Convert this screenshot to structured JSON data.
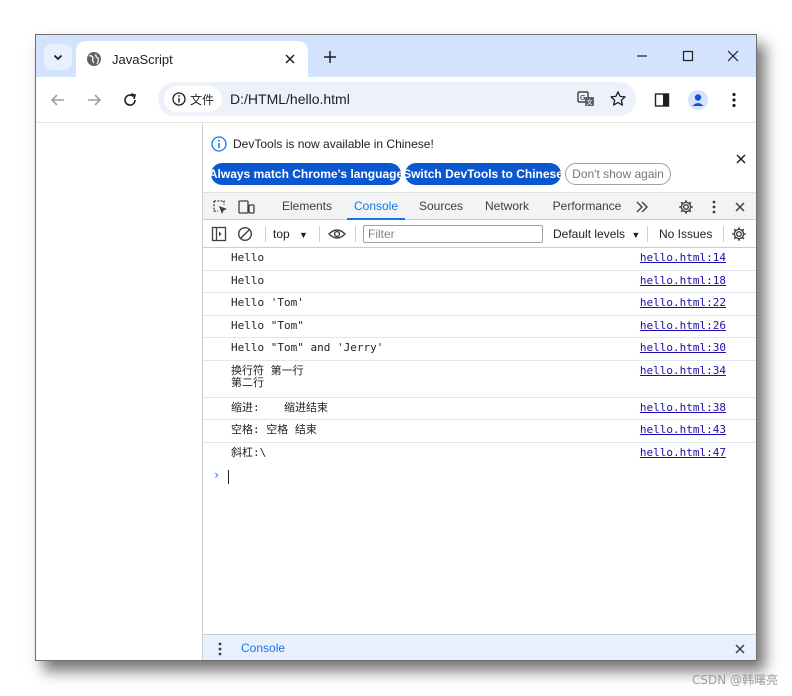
{
  "browser": {
    "tab_title": "JavaScript",
    "site_chip_label": "文件",
    "url": "D:/HTML/hello.html"
  },
  "devtools": {
    "infobar": {
      "message": "DevTools is now available in Chinese!",
      "btn_match": "Always match Chrome's language",
      "btn_switch": "Switch DevTools to Chinese",
      "btn_dismiss": "Don't show again"
    },
    "tabs": [
      "Elements",
      "Console",
      "Sources",
      "Network",
      "Performance"
    ],
    "active_tab": "Console",
    "console_toolbar": {
      "context": "top",
      "filter_placeholder": "Filter",
      "levels": "Default levels",
      "issues": "No Issues"
    },
    "logs": [
      {
        "msg": "Hello",
        "src": "hello.html:14"
      },
      {
        "msg": "Hello",
        "src": "hello.html:18"
      },
      {
        "msg": "Hello 'Tom'",
        "src": "hello.html:22"
      },
      {
        "msg": "Hello \"Tom\"",
        "src": "hello.html:26"
      },
      {
        "msg": "Hello \"Tom\" and 'Jerry'",
        "src": "hello.html:30"
      },
      {
        "msg": "换行符 第一行\n第二行",
        "src": "hello.html:34"
      },
      {
        "msg": "缩进:\t缩进结束",
        "src": "hello.html:38"
      },
      {
        "msg": "空格: 空格 结束",
        "src": "hello.html:43"
      },
      {
        "msg": "斜杠:\\",
        "src": "hello.html:47"
      }
    ],
    "drawer_tab": "Console"
  },
  "watermark": "CSDN @韩曙亮",
  "colors": {
    "accent": "#1a73e8",
    "titlebar": "#d3e3fd",
    "primary_button": "#0b57d0"
  }
}
